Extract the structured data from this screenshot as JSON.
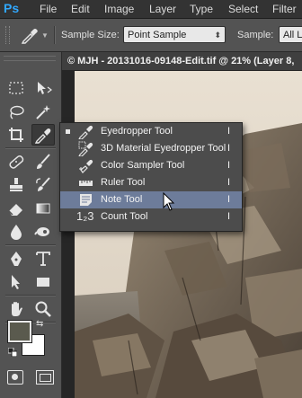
{
  "menubar": {
    "logo": "Ps",
    "items": [
      "File",
      "Edit",
      "Image",
      "Layer",
      "Type",
      "Select",
      "Filter"
    ]
  },
  "options": {
    "sample_size_label": "Sample Size:",
    "sample_size_value": "Point Sample",
    "sample_label": "Sample:",
    "sample_value": "All La"
  },
  "document": {
    "title": "© MJH - 20131016-09148-Edit.tif @ 21% (Layer 8,"
  },
  "flyout": {
    "items": [
      {
        "label": "Eyedropper Tool",
        "shortcut": "I",
        "icon": "eyedropper-icon",
        "current": true,
        "selected": false
      },
      {
        "label": "3D Material Eyedropper Tool",
        "shortcut": "I",
        "icon": "3d-material-eyedropper-icon",
        "current": false,
        "selected": false
      },
      {
        "label": "Color Sampler Tool",
        "shortcut": "I",
        "icon": "color-sampler-icon",
        "current": false,
        "selected": false
      },
      {
        "label": "Ruler Tool",
        "shortcut": "I",
        "icon": "ruler-icon",
        "current": false,
        "selected": false
      },
      {
        "label": "Note Tool",
        "shortcut": "I",
        "icon": "note-icon",
        "current": false,
        "selected": true
      },
      {
        "label": "Count Tool",
        "shortcut": "I",
        "icon": "count-icon",
        "current": false,
        "selected": false
      }
    ],
    "count_glyph": "1₂3"
  },
  "colors": {
    "accent_selected": "#6d7c9a",
    "foreground_swatch": "#5a5a4e",
    "background_swatch": "#ffffff",
    "ps_blue": "#31a8ff"
  }
}
